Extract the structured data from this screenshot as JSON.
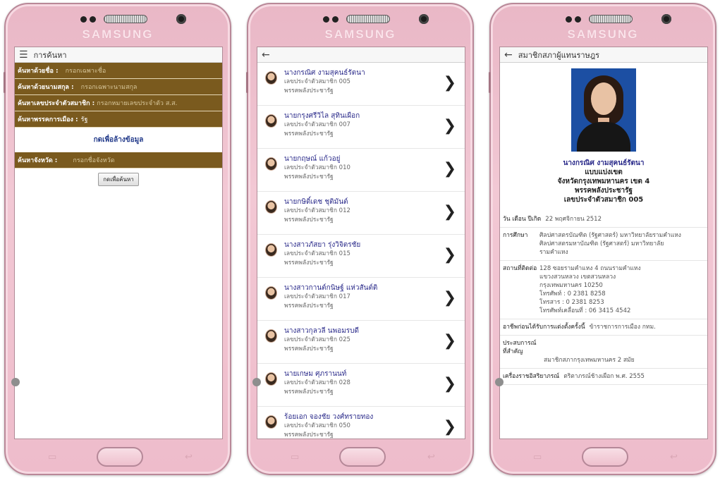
{
  "device": {
    "brand": "SAMSUNG"
  },
  "search_screen": {
    "title": "การค้นหา",
    "fields": [
      {
        "label": "ค้นหาด้วยชื่อ :",
        "placeholder": "กรอกเฉพาะชื่อ"
      },
      {
        "label": "ค้นหาด้วยนามสกุล :",
        "placeholder": "กรอกเฉพาะนามสกุล"
      },
      {
        "label": "ค้นหาเลขประจำตัวสมาชิก :",
        "placeholder": "กรอกหมายเลขประจำตัว ส.ส."
      },
      {
        "label": "ค้นหาพรรคการเมือง :",
        "value": "รัฐ"
      }
    ],
    "clear_link": "กดเพื่อล้างข้อมูล",
    "province_field": {
      "label": "ค้นหาจังหวัด :",
      "placeholder": "กรอกชื่อจังหวัด"
    },
    "search_button": "กดเพื่อค้นหา"
  },
  "list_screen": {
    "members": [
      {
        "name": "นางกรณิศ งามสุคนธ์รัตนา",
        "id": "เลขประจำตัวสมาชิก 005",
        "party": "พรรคพลังประชารัฐ"
      },
      {
        "name": "นายกรุงศรีวิไล สุทินเผือก",
        "id": "เลขประจำตัวสมาชิก 007",
        "party": "พรรคพลังประชารัฐ"
      },
      {
        "name": "นายกฤษณ์ แก้วอยู่",
        "id": "เลขประจำตัวสมาชิก 010",
        "party": "พรรคพลังประชารัฐ"
      },
      {
        "name": "นายกษิดิ์เดช ชุติมันต์",
        "id": "เลขประจำตัวสมาชิก 012",
        "party": "พรรคพลังประชารัฐ"
      },
      {
        "name": "นางสาวภัสยา รุ่งวิจิตรชัย",
        "id": "เลขประจำตัวสมาชิก 015",
        "party": "พรรคพลังประชารัฐ"
      },
      {
        "name": "นางสาวกานต์กนิษฐ์ แห่วสันต์ติ",
        "id": "เลขประจำตัวสมาชิก 017",
        "party": "พรรคพลังประชารัฐ"
      },
      {
        "name": "นางสาวกุลวลี นพอมรบดี",
        "id": "เลขประจำตัวสมาชิก 025",
        "party": "พรรคพลังประชารัฐ"
      },
      {
        "name": "นายเกษม ศุภรานนท์",
        "id": "เลขประจำตัวสมาชิก 028",
        "party": "พรรคพลังประชารัฐ"
      },
      {
        "name": "ร้อยเอก จองชัย วงศ์ทรายทอง",
        "id": "เลขประจำตัวสมาชิก 050",
        "party": "พรรคพลังประชารัฐ"
      }
    ]
  },
  "detail_screen": {
    "title": "สมาชิกสภาผู้แทนราษฎร",
    "name": "นางกรณิศ งามสุคนธ์รัตนา",
    "type": "แบบแบ่งเขต",
    "district": "จังหวัดกรุงเทพมหานคร เขต 4",
    "party": "พรรคพลังประชารัฐ",
    "member_id": "เลขประจำตัวสมาชิก 005",
    "birth_label": "วัน เดือน ปีเกิด",
    "birth_value": "22 พฤศจิกายน 2512",
    "edu_label": "การศึกษา",
    "edu_lines": [
      "ศิลปศาสตรบัณฑิต (รัฐศาสตร์) มหาวิทยาลัยรามคำแหง",
      "ศิลปศาสตรมหาบัณฑิต (รัฐศาสตร์) มหาวิทยาลัย",
      "รามคำแหง"
    ],
    "contact_label": "สถานที่ติดต่อ",
    "contact_lines": [
      "128 ซอยรามคำแหง 4 ถนนรามคำแหง",
      "แขวงสวนหลวง เขตสวนหลวง",
      "กรุงเทพมหานคร 10250",
      "โทรศัพท์ : 0 2381 8258",
      "โทรสาร : 0 2381 8253",
      "โทรศัพท์เคลื่อนที่ : 06 3415 4542"
    ],
    "prev_job_label": "อาชีพก่อนได้รับการแต่งตั้งครั้งนี้",
    "prev_job_value": "ข้าราชการการเมือง กทม.",
    "exp_label": "ประสบการณ์ที่สำคัญ",
    "exp_value": "สมาชิกสภากรุงเทพมหานคร 2 สมัย",
    "decor_label": "เครื่องราชอิสริยาภรณ์",
    "decor_value": "ตริตาภรณ์ช้างเผือก พ.ศ. 2555"
  }
}
